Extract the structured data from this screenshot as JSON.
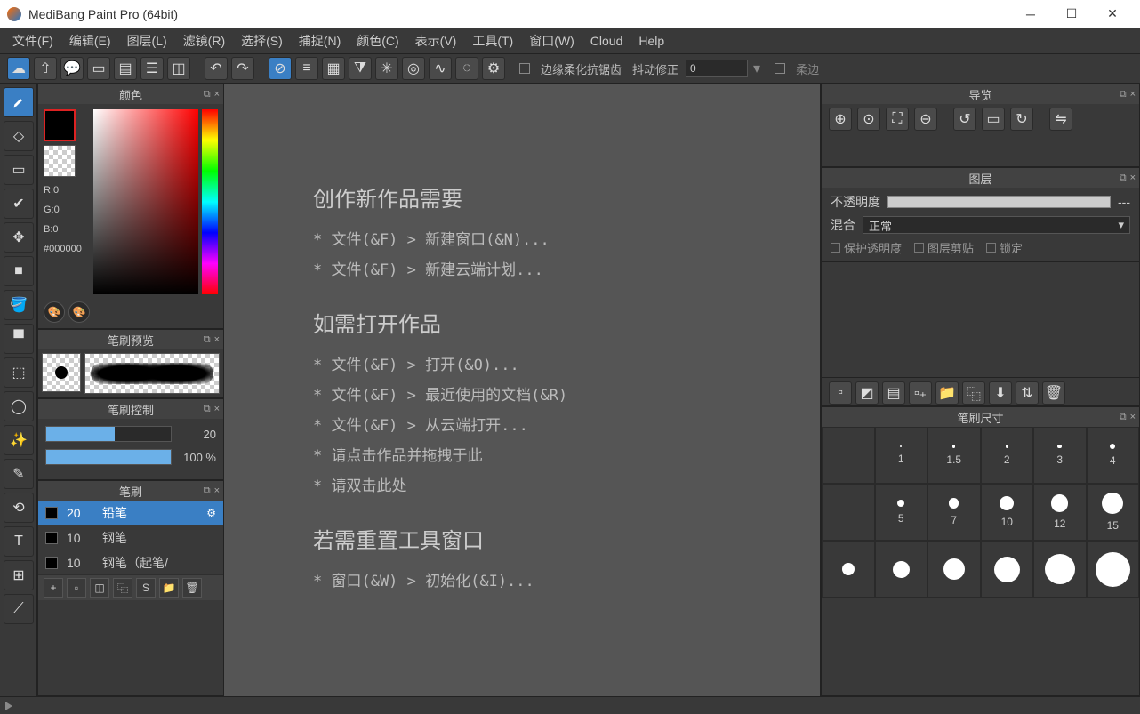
{
  "window": {
    "title": "MediBang Paint Pro (64bit)"
  },
  "menu": [
    "文件(F)",
    "编辑(E)",
    "图层(L)",
    "滤镜(R)",
    "选择(S)",
    "捕捉(N)",
    "颜色(C)",
    "表示(V)",
    "工具(T)",
    "窗口(W)",
    "Cloud",
    "Help"
  ],
  "toolbar": {
    "antialias": "边缘柔化抗锯齿",
    "shake_correction": "抖动修正",
    "shake_value": "0",
    "soft_edge": "柔边"
  },
  "panels": {
    "color": {
      "title": "颜色",
      "r": "R:0",
      "g": "G:0",
      "b": "B:0",
      "hex": "#000000"
    },
    "brush_preview": {
      "title": "笔刷预览"
    },
    "brush_control": {
      "title": "笔刷控制",
      "size_value": "20",
      "opacity_value": "100 %"
    },
    "brush": {
      "title": "笔刷",
      "items": [
        {
          "size": "20",
          "name": "铅笔",
          "selected": true
        },
        {
          "size": "10",
          "name": "钢笔",
          "selected": false
        },
        {
          "size": "10",
          "name": "钢笔（起笔/",
          "selected": false
        }
      ]
    },
    "navigator": {
      "title": "导览"
    },
    "layers": {
      "title": "图层",
      "opacity_label": "不透明度",
      "opacity_dash": "---",
      "blend_label": "混合",
      "blend_mode": "正常",
      "protect_alpha": "保护透明度",
      "clipping": "图层剪贴",
      "lock": "锁定"
    },
    "brush_size": {
      "title": "笔刷尺寸",
      "rows": [
        [
          {
            "s": 1,
            "d": 1
          },
          {
            "s": 1.5,
            "d": 2
          },
          {
            "s": 2,
            "d": 2
          },
          {
            "s": 3,
            "d": 3
          },
          {
            "s": 4,
            "d": 4
          }
        ],
        [
          {
            "s": 5,
            "d": 5
          },
          {
            "s": 7,
            "d": 7
          },
          {
            "s": 10,
            "d": 10
          },
          {
            "s": 12,
            "d": 12
          },
          {
            "s": 15,
            "d": 15
          }
        ]
      ]
    }
  },
  "welcome": {
    "section1_title": "创作新作品需要",
    "section1_lines": [
      "* 文件(&F) > 新建窗口(&N)...",
      "* 文件(&F) > 新建云端计划..."
    ],
    "section2_title": "如需打开作品",
    "section2_lines": [
      "* 文件(&F) > 打开(&O)...",
      "* 文件(&F) > 最近使用的文档(&R)",
      "* 文件(&F) > 从云端打开...",
      "* 请点击作品并拖拽于此",
      "* 请双击此处"
    ],
    "section3_title": "若需重置工具窗口",
    "section3_lines": [
      "* 窗口(&W) > 初始化(&I)..."
    ]
  }
}
